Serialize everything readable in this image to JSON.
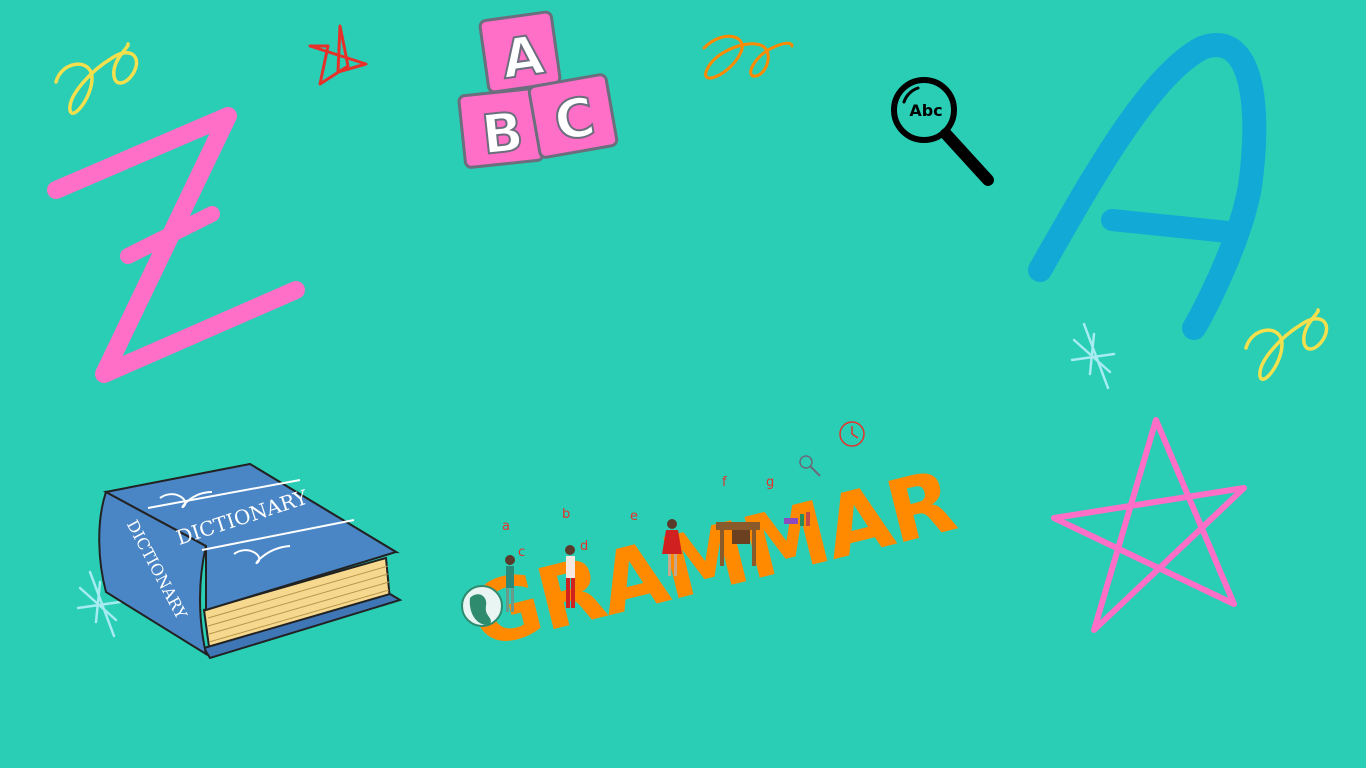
{
  "slide": {
    "background": "#29ceb5",
    "blocks": {
      "top": "A",
      "left": "B",
      "right": "C"
    },
    "magnifier_text": "Abc",
    "big_left_letter": "Z",
    "big_right_letter": "A",
    "dictionary": {
      "cover": "DICTIONARY",
      "spine": "DICTIONARY"
    },
    "grammar": {
      "word": "GRAMMAR",
      "small_letters": [
        "a",
        "b",
        "c",
        "d",
        "e",
        "f",
        "g"
      ]
    },
    "colors": {
      "pink": "#ff6ec7",
      "blue": "#12a9d6",
      "orange": "#ff8a00",
      "yellow": "#f4e04d",
      "red": "#e8302a",
      "book_blue": "#4a86c5",
      "light_cyan": "#a6ecf0"
    },
    "icons": [
      "scribble-icon",
      "star-icon",
      "abc-blocks-icon",
      "magnifier-icon",
      "sparkle-icon",
      "dictionary-book-icon",
      "globe-icon"
    ]
  }
}
